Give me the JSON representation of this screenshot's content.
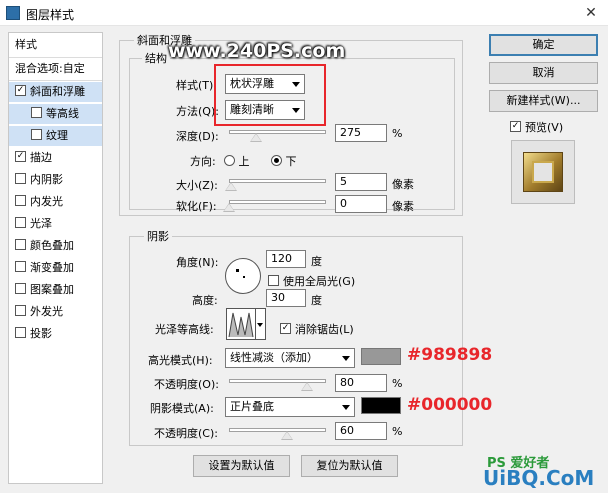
{
  "window": {
    "title": "图层样式",
    "close": "✕"
  },
  "watermark_top": "www.240PS.com",
  "watermark_bottom": "UiBQ.CoM",
  "watermark_logo": "PS 爱好者",
  "sidebar": {
    "heading": "样式",
    "blend": "混合选项:自定",
    "items": [
      {
        "label": "斜面和浮雕",
        "checked": true,
        "selected": true,
        "sub": false
      },
      {
        "label": "等高线",
        "checked": false,
        "selected": true,
        "sub": true
      },
      {
        "label": "纹理",
        "checked": false,
        "selected": true,
        "sub": true
      },
      {
        "label": "描边",
        "checked": true,
        "selected": false,
        "sub": false
      },
      {
        "label": "内阴影",
        "checked": false,
        "selected": false,
        "sub": false
      },
      {
        "label": "内发光",
        "checked": false,
        "selected": false,
        "sub": false
      },
      {
        "label": "光泽",
        "checked": false,
        "selected": false,
        "sub": false
      },
      {
        "label": "颜色叠加",
        "checked": false,
        "selected": false,
        "sub": false
      },
      {
        "label": "渐变叠加",
        "checked": false,
        "selected": false,
        "sub": false
      },
      {
        "label": "图案叠加",
        "checked": false,
        "selected": false,
        "sub": false
      },
      {
        "label": "外发光",
        "checked": false,
        "selected": false,
        "sub": false
      },
      {
        "label": "投影",
        "checked": false,
        "selected": false,
        "sub": false
      }
    ]
  },
  "bevel": {
    "section_title": "斜面和浮雕",
    "struct_title": "结构",
    "style_label": "样式(T):",
    "style_value": "枕状浮雕",
    "method_label": "方法(Q):",
    "method_value": "雕刻清晰",
    "depth_label": "深度(D):",
    "depth_value": "275",
    "depth_unit": "%",
    "depth_fraction": 0.28,
    "direction_label": "方向:",
    "dir_up": "上",
    "dir_down": "下",
    "size_label": "大小(Z):",
    "size_value": "5",
    "size_unit": "像素",
    "size_fraction": 0.02,
    "soften_label": "软化(F):",
    "soften_value": "0",
    "soften_unit": "像素",
    "soften_fraction": 0.0
  },
  "shading": {
    "title": "阴影",
    "angle_label": "角度(N):",
    "angle_value": "120",
    "angle_unit": "度",
    "global_light": "使用全局光(G)",
    "altitude_label": "高度:",
    "altitude_value": "30",
    "altitude_unit": "度",
    "gloss_label": "光泽等高线:",
    "antialias": "消除锯齿(L)",
    "highlight_label": "高光模式(H):",
    "highlight_mode": "线性减淡（添加）",
    "highlight_color": "#989898",
    "highlight_color_text": "#989898",
    "opacity1_label": "不透明度(O):",
    "opacity1_value": "80",
    "opacity1_unit": "%",
    "opacity1_fraction": 0.8,
    "shadow_label": "阴影模式(A):",
    "shadow_mode": "正片叠底",
    "shadow_color": "#000000",
    "shadow_color_text": "#000000",
    "opacity2_label": "不透明度(C):",
    "opacity2_value": "60",
    "opacity2_unit": "%",
    "opacity2_fraction": 0.6
  },
  "buttons": {
    "set_default": "设置为默认值",
    "reset_default": "复位为默认值",
    "ok": "确定",
    "cancel": "取消",
    "new_style": "新建样式(W)...",
    "preview": "预览(V)"
  },
  "colors": {
    "annotation_red": "#e8262b",
    "accent_blue": "#3c7fb1"
  }
}
